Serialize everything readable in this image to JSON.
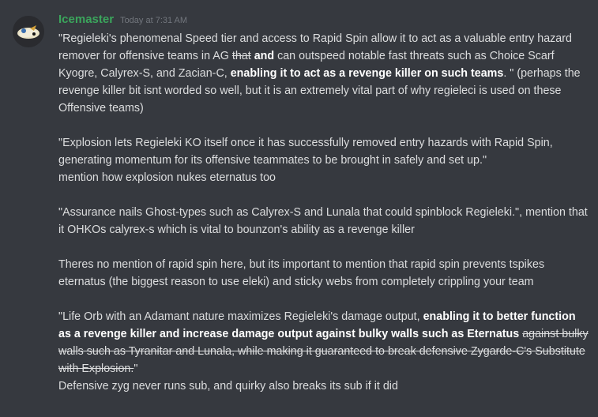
{
  "message": {
    "username": "Icemaster",
    "timestamp": "Today at 7:31 AM",
    "p1": {
      "t1": "\"Regieleki's phenomenal Speed tier and access to Rapid Spin allow it to act as a valuable entry hazard remover for offensive teams in AG ",
      "s1": "that",
      "t2": " ",
      "b1": "and",
      "t3": " can outspeed notable fast threats such as Choice Scarf Kyogre, Calyrex-S, and Zacian-C, ",
      "b2": "enabling it to act as a revenge killer on such teams",
      "t4": ". \" (perhaps the revenge killer bit isnt worded so well, but it is an extremely vital part of why regieleci is used on these Offensive teams)"
    },
    "p2": {
      "quote": "\"Explosion lets Regieleki KO itself once it has successfully removed entry hazards with Rapid Spin, generating momentum for its offensive teammates to be brought in safely and set up.\"",
      "note": "mention how explosion nukes eternatus too"
    },
    "p3": " \"Assurance nails Ghost-types such as Calyrex-S and Lunala that could spinblock Regieleki.\", mention that it OHKOs calyrex-s which is vital to bounzon's ability as a revenge killer",
    "p4": "Theres no mention of rapid spin here, but its important to mention that rapid spin prevents tspikes eternatus (the biggest reason to use eleki) and sticky webs from completely crippling your team",
    "p5": {
      "t1": "\"Life Orb with an Adamant nature maximizes Regieleki's damage output, ",
      "b1": "enabling it to better function as a revenge killer and increase damage output against bulky walls such as Eternatus",
      "s1": "against bulky walls such as Tyranitar and Lunala, while making it guaranteed to break defensive Zygarde-C's Substitute with Explosion.",
      "t2": "\"",
      "note": "Defensive zyg never runs sub, and quirky also breaks its sub if it did"
    }
  }
}
